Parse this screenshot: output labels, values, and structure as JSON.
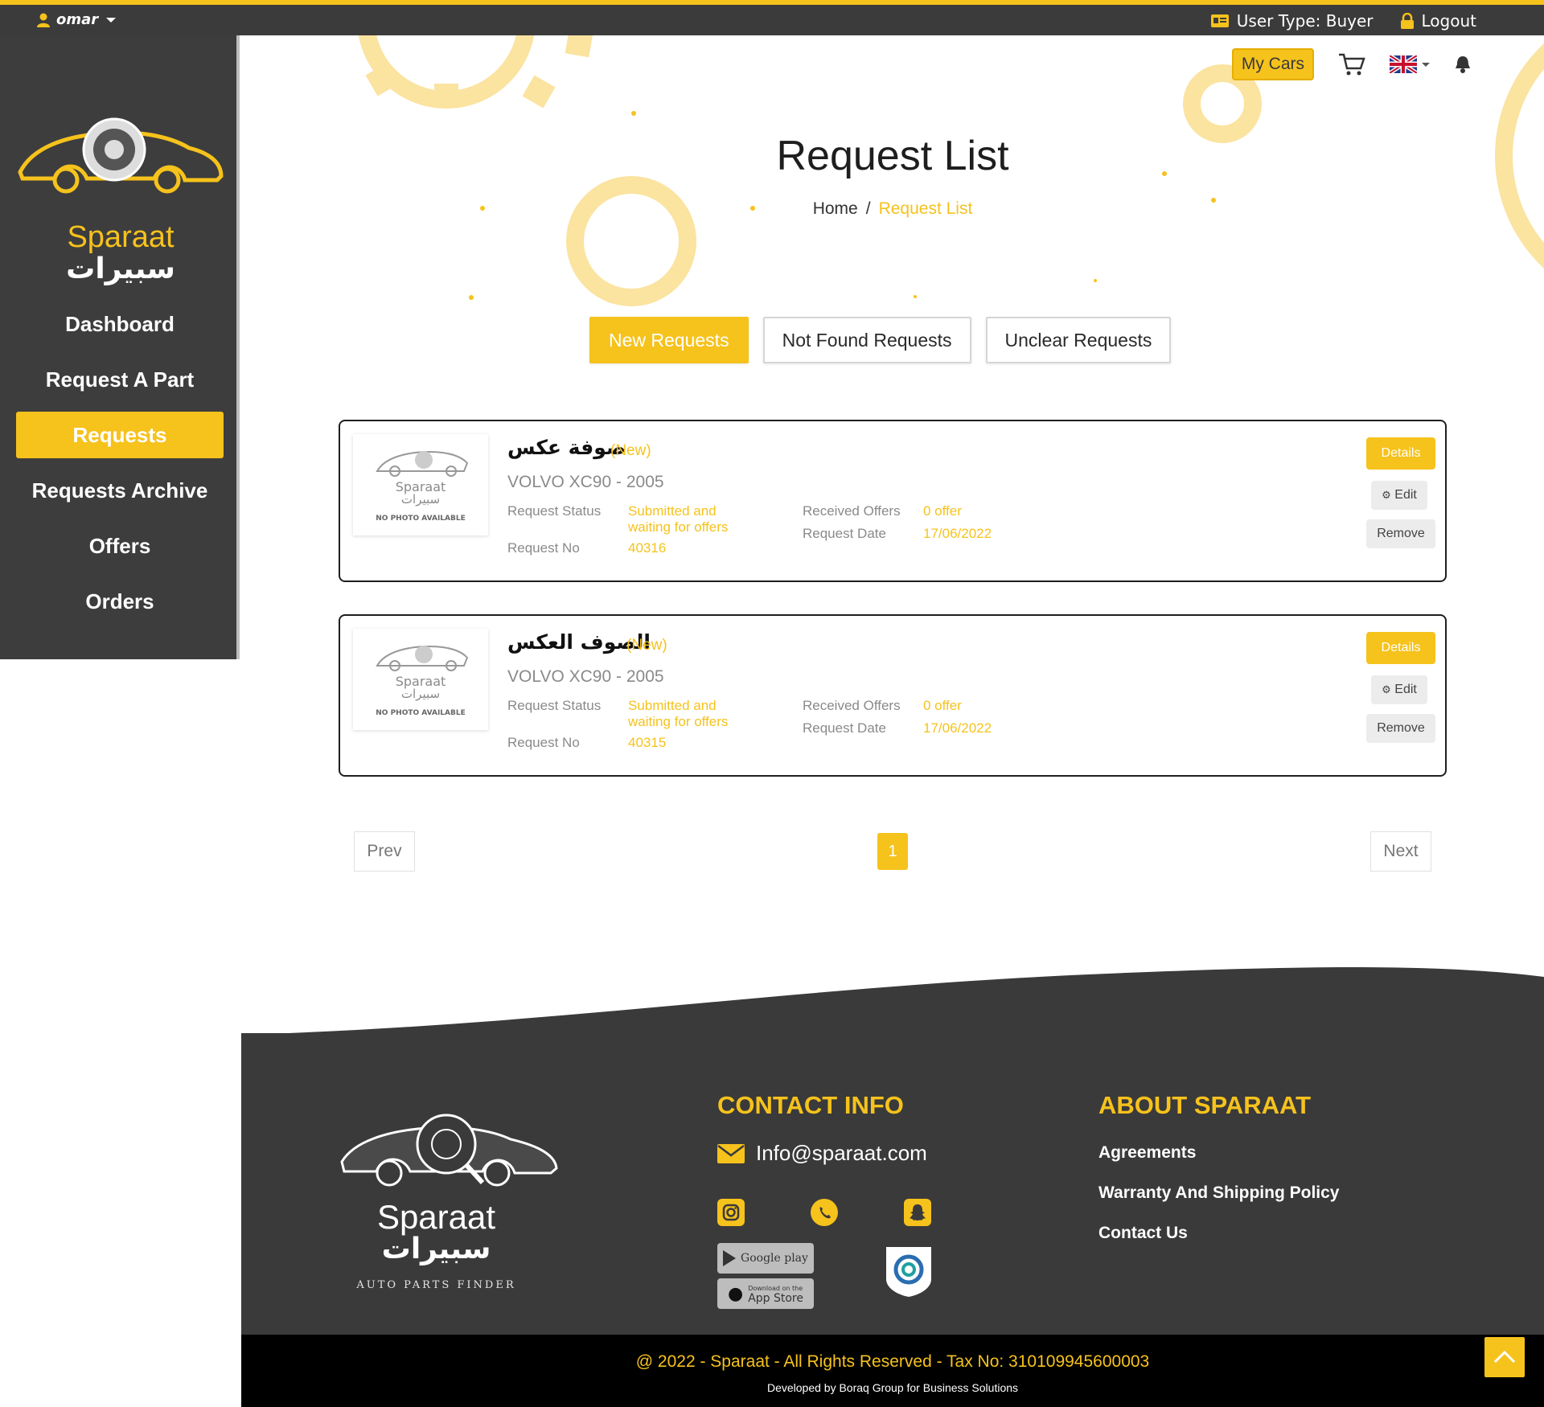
{
  "topbar": {
    "username": "omar",
    "user_type": "User Type: Buyer",
    "logout": "Logout"
  },
  "brand": {
    "name_en": "Sparaat",
    "name_ar": "سبيرات",
    "tagline": "AUTO PARTS FINDER"
  },
  "sidebar": {
    "items": [
      {
        "label": "Dashboard",
        "active": false
      },
      {
        "label": "Request A Part",
        "active": false
      },
      {
        "label": "Requests",
        "active": true
      },
      {
        "label": "Requests Archive",
        "active": false
      },
      {
        "label": "Offers",
        "active": false
      },
      {
        "label": "Orders",
        "active": false
      }
    ]
  },
  "header": {
    "my_cars": "My Cars",
    "cart_icon": "cart-icon",
    "language": "en",
    "notification_icon": "bell-icon"
  },
  "page": {
    "title": "Request List",
    "breadcrumb_home": "Home",
    "breadcrumb_separator": "/",
    "breadcrumb_current": "Request List"
  },
  "tabs": [
    {
      "label": "New Requests",
      "active": true
    },
    {
      "label": "Not Found Requests",
      "active": false
    },
    {
      "label": "Unclear Requests",
      "active": false
    }
  ],
  "requests": [
    {
      "part_name": "صوفة عكس",
      "badge": "(New)",
      "car": "VOLVO XC90 - 2005",
      "status_label": "Request Status",
      "status_value_line1": "Submitted and",
      "status_value_line2": "waiting for offers",
      "request_no_label": "Request No",
      "request_no": "40316",
      "offers_label": "Received Offers",
      "offers_value": "0 offer",
      "date_label": "Request Date",
      "date_value": "17/06/2022",
      "details": "Details",
      "edit": "Edit",
      "remove": "Remove",
      "thumb_name_en": "Sparaat",
      "thumb_name_ar": "سبيرات",
      "thumb_no_photo": "NO PHOTO AVAILABLE"
    },
    {
      "part_name": "الصوف العكس",
      "badge": "(New)",
      "car": "VOLVO XC90 - 2005",
      "status_label": "Request Status",
      "status_value_line1": "Submitted and",
      "status_value_line2": "waiting for offers",
      "request_no_label": "Request No",
      "request_no": "40315",
      "offers_label": "Received Offers",
      "offers_value": "0 offer",
      "date_label": "Request Date",
      "date_value": "17/06/2022",
      "details": "Details",
      "edit": "Edit",
      "remove": "Remove",
      "thumb_name_en": "Sparaat",
      "thumb_name_ar": "سبيرات",
      "thumb_no_photo": "NO PHOTO AVAILABLE"
    }
  ],
  "pagination": {
    "prev": "Prev",
    "current": "1",
    "next": "Next"
  },
  "footer": {
    "contact_heading": "CONTACT INFO",
    "email": "Info@sparaat.com",
    "about_heading": "ABOUT SPARAAT",
    "about_links": [
      "Agreements",
      "Warranty And Shipping Policy",
      "Contact Us"
    ],
    "google_play": "Google play",
    "app_store_small": "Download on the",
    "app_store": "App Store",
    "social_icons": [
      "instagram-icon",
      "whatsapp-icon",
      "snapchat-icon"
    ],
    "copyright": "@ 2022 - Sparaat - All Rights Reserved - Tax No: 310109945600003",
    "developed_by": "Developed by Boraq Group for Business Solutions"
  },
  "colors": {
    "accent": "#f6c21c",
    "dark": "#3a3a3a",
    "footer_bottom": "#000000"
  }
}
